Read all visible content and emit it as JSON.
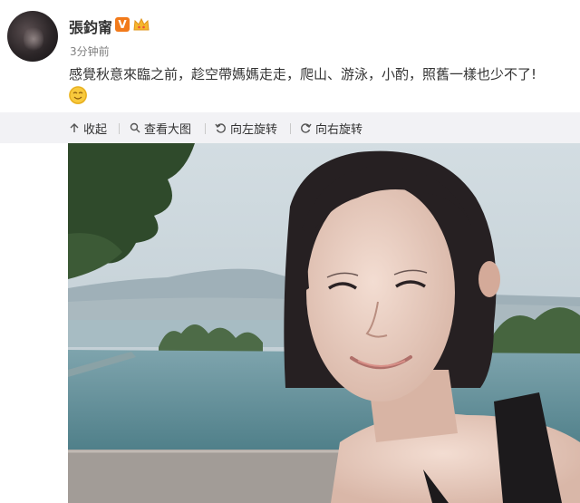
{
  "user": {
    "name": "張鈞甯",
    "verified_badge": "V",
    "time": "3分钟前"
  },
  "post": {
    "text": "感覺秋意來臨之前，趁空帶媽媽走走，爬山、游泳，小酌，照舊一樣也少不了!",
    "emoji": "emoji-icon"
  },
  "toolbar": {
    "collapse": "收起",
    "view_large": "查看大图",
    "rotate_left": "向左旋转",
    "rotate_right": "向右旋转"
  },
  "colors": {
    "badge": "#f27a1a",
    "toolbar_bg": "#f2f2f5"
  }
}
